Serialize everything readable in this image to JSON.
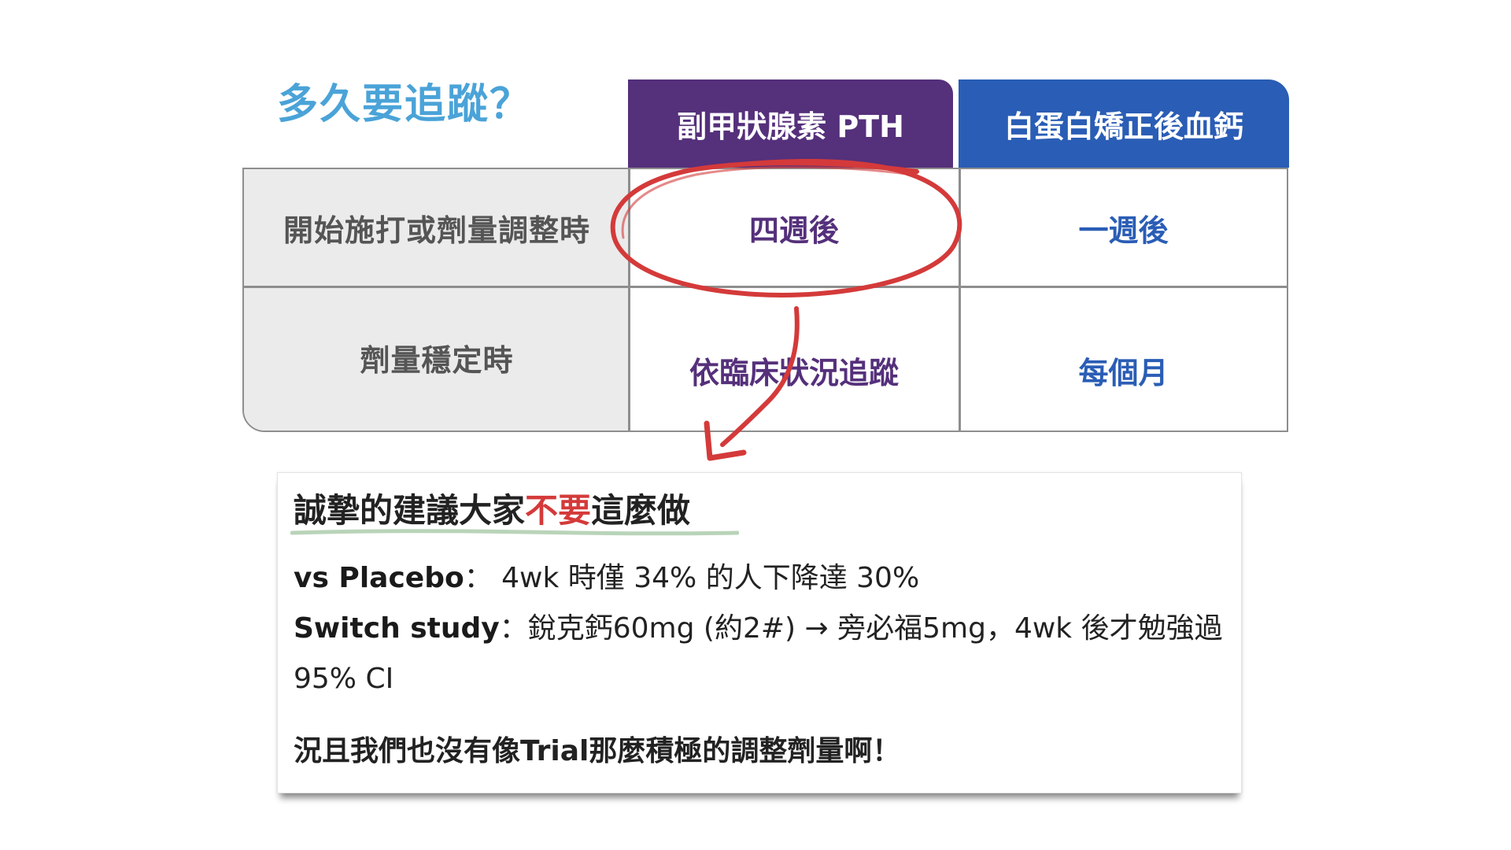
{
  "title": "多久要追蹤？",
  "columns": {
    "pth": "副甲狀腺素 PTH",
    "calcium": "白蛋白矯正後血鈣"
  },
  "rows": [
    {
      "label": "開始施打或劑量調整時",
      "pth": "四週後",
      "calcium": "一週後"
    },
    {
      "label": "劑量穩定時",
      "pth": "依臨床狀況追蹤",
      "calcium": "每個月"
    }
  ],
  "colors": {
    "title": "#4aa3d8",
    "pth": "#55307b",
    "calcium": "#2a5db5",
    "annotation": "#d43a3a"
  },
  "note": {
    "heading_pre": "誠摯的建議大家",
    "heading_emphasis": "不要",
    "heading_post": "這麼做",
    "line1_label": "vs Placebo",
    "line1_text": "： 4wk 時僅 34% 的人下降達 30%",
    "line2_label": "Switch study",
    "line2_text": "：銳克鈣60mg (約2#) → 旁必福5mg，4wk 後才勉強過",
    "line3_text": "95% CI",
    "line4_text": "況且我們也沒有像Trial那麼積極的調整劑量啊！"
  }
}
